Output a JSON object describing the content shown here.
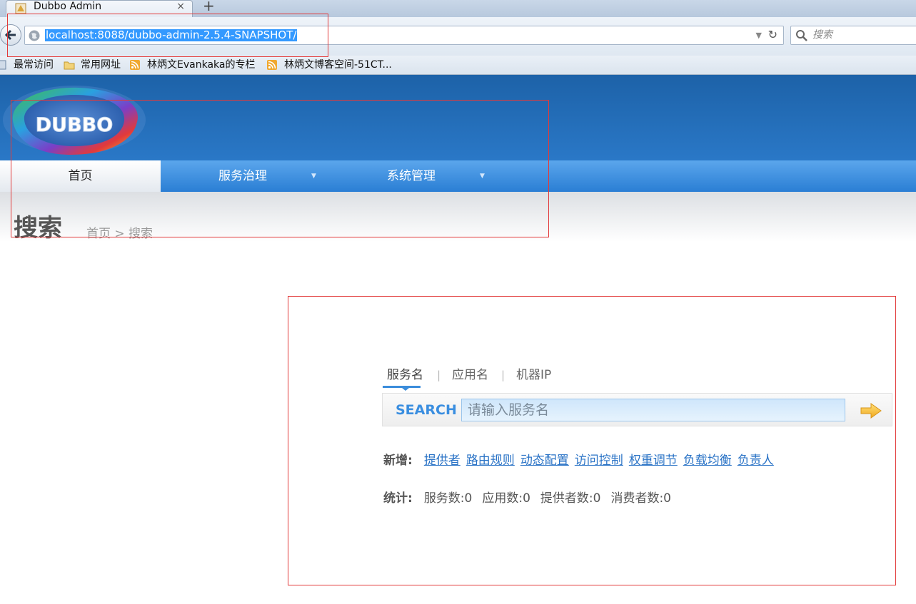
{
  "browser": {
    "tab_title": "Dubbo Admin",
    "tab_close": "×",
    "new_tab": "+",
    "url": "localhost:8088/dubbo-admin-2.5.4-SNAPSHOT/",
    "search_placeholder": "搜索"
  },
  "bookmarks": [
    "最常访问",
    "常用网址",
    "林炳文Evankaka的专栏",
    "林炳文博客空间-51CT..."
  ],
  "logo_text": "DUBBO",
  "menu": {
    "home": "首页",
    "service_governance": "服务治理",
    "system_management": "系统管理"
  },
  "page": {
    "title": "搜索",
    "breadcrumb": "首页 > 搜索"
  },
  "search": {
    "tabs": [
      "服务名",
      "应用名",
      "机器IP"
    ],
    "separator": "|",
    "label": "SEARCH",
    "placeholder": "请输入服务名"
  },
  "add": {
    "label": "新增:",
    "links": [
      "提供者",
      "路由规则",
      "动态配置",
      "访问控制",
      "权重调节",
      "负载均衡",
      "负责人"
    ]
  },
  "stats": {
    "label": "统计:",
    "items": [
      "服务数:0",
      "应用数:0",
      "提供者数:0",
      "消费者数:0"
    ]
  },
  "colors": {
    "header_blue": "#1d62a8",
    "menu_blue": "#2a7ed4",
    "link_blue": "#2a73c6",
    "annotation_red": "#e23a3a"
  }
}
